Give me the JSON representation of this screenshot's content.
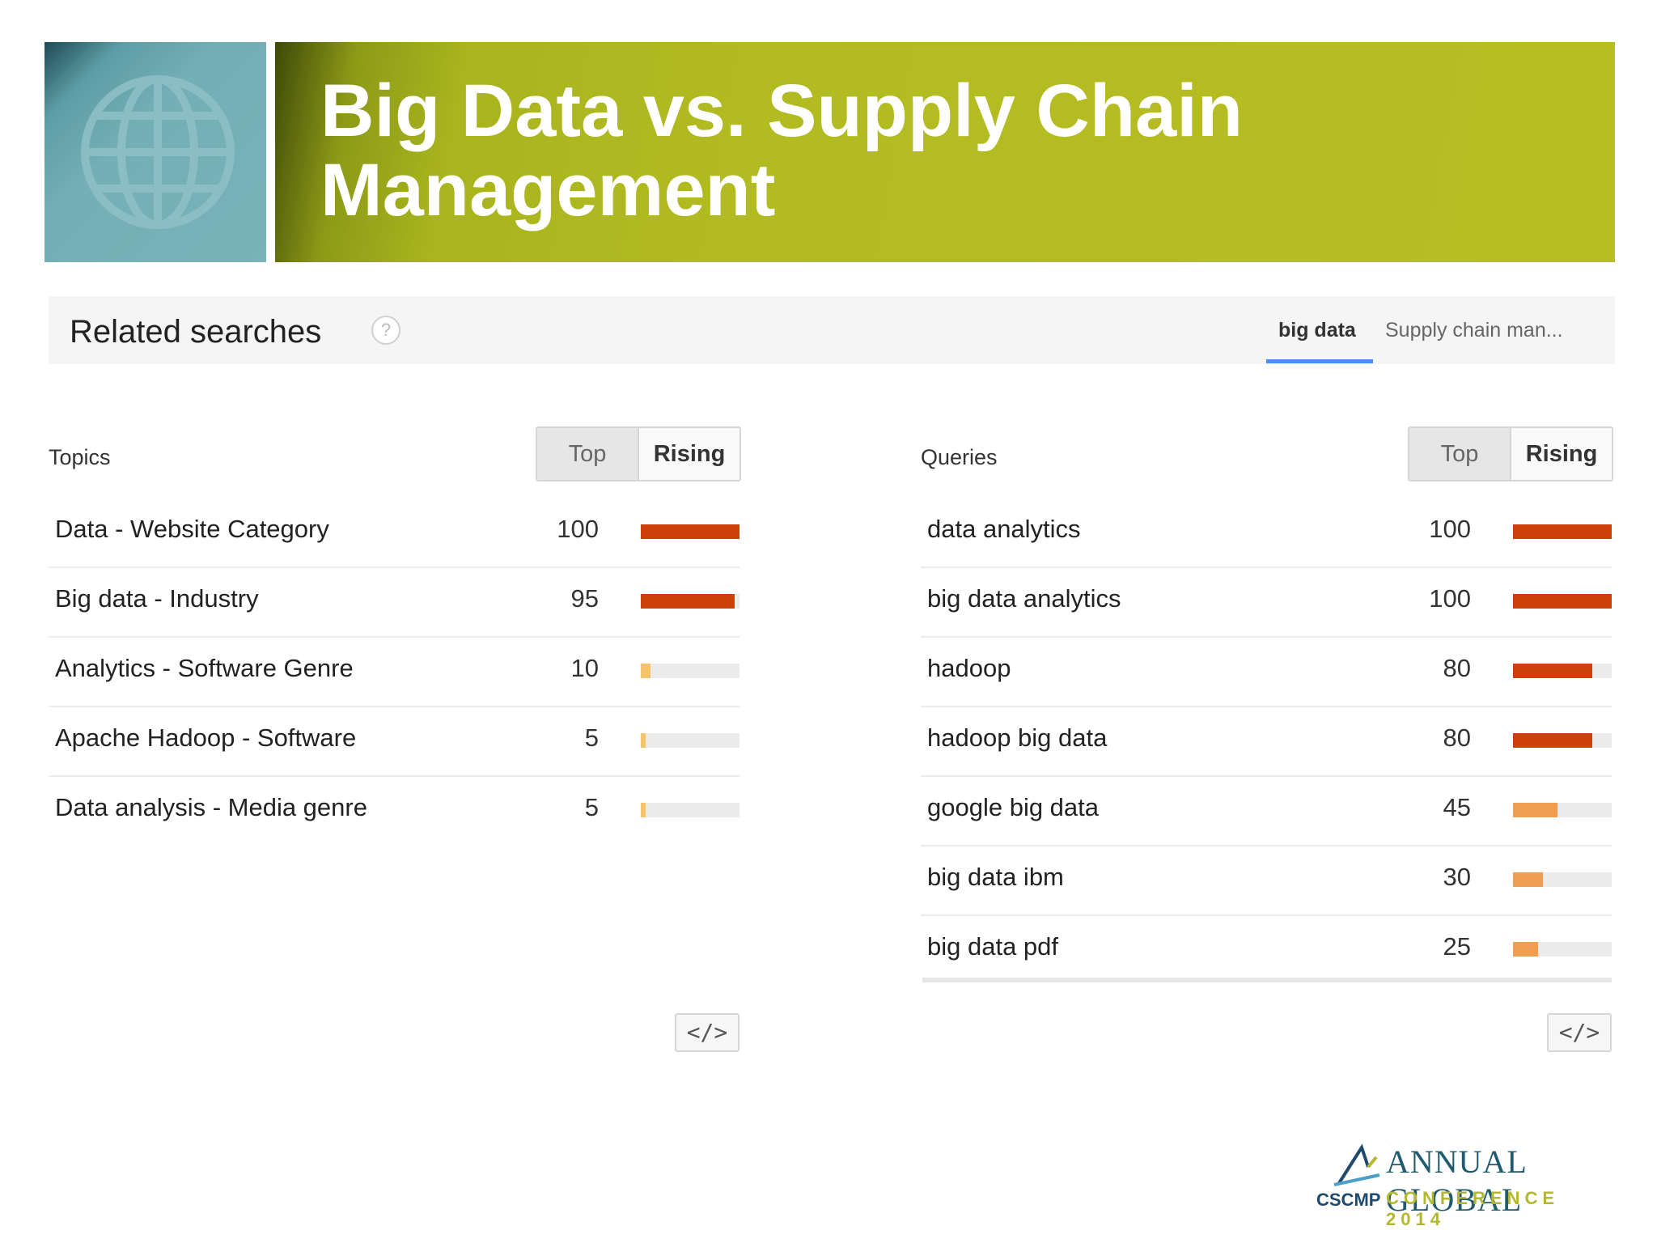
{
  "header": {
    "title_line1": "Big Data vs. Supply Chain",
    "title_line2": "Management"
  },
  "related": {
    "title": "Related searches",
    "help": "?",
    "tabs": [
      "big data",
      "Supply chain man..."
    ],
    "active_tab": "big data"
  },
  "topics": {
    "heading": "Topics",
    "toggle": {
      "top": "Top",
      "rising": "Rising",
      "active": "Top"
    },
    "rows": [
      {
        "label": "Data - Website Category",
        "value": "100",
        "level": 100,
        "color": "#d0400c"
      },
      {
        "label": "Big data - Industry",
        "value": "95",
        "level": 95,
        "color": "#d0400c"
      },
      {
        "label": "Analytics - Software Genre",
        "value": "10",
        "level": 10,
        "color": "#f5c46a"
      },
      {
        "label": "Apache Hadoop - Software",
        "value": "5",
        "level": 5,
        "color": "#f5c46a"
      },
      {
        "label": "Data analysis - Media genre",
        "value": "5",
        "level": 5,
        "color": "#f5c46a"
      }
    ],
    "embed": "</>"
  },
  "queries": {
    "heading": "Queries",
    "toggle": {
      "top": "Top",
      "rising": "Rising",
      "active": "Top"
    },
    "rows": [
      {
        "label": "data analytics",
        "value": "100",
        "level": 100,
        "color": "#d0400c"
      },
      {
        "label": "big data analytics",
        "value": "100",
        "level": 100,
        "color": "#d0400c"
      },
      {
        "label": "hadoop",
        "value": "80",
        "level": 80,
        "color": "#d0400c"
      },
      {
        "label": "hadoop big data",
        "value": "80",
        "level": 80,
        "color": "#d0400c"
      },
      {
        "label": "google big data",
        "value": "45",
        "level": 45,
        "color": "#ef9f4f"
      },
      {
        "label": "big data ibm",
        "value": "30",
        "level": 30,
        "color": "#ef9f4f"
      },
      {
        "label": "big data pdf",
        "value": "25",
        "level": 25,
        "color": "#ef9f4f"
      }
    ],
    "embed": "</>"
  },
  "logo": {
    "line1": "ANNUAL GLOBAL",
    "line2": "CONFERENCE 2014",
    "org": "CSCMP"
  }
}
